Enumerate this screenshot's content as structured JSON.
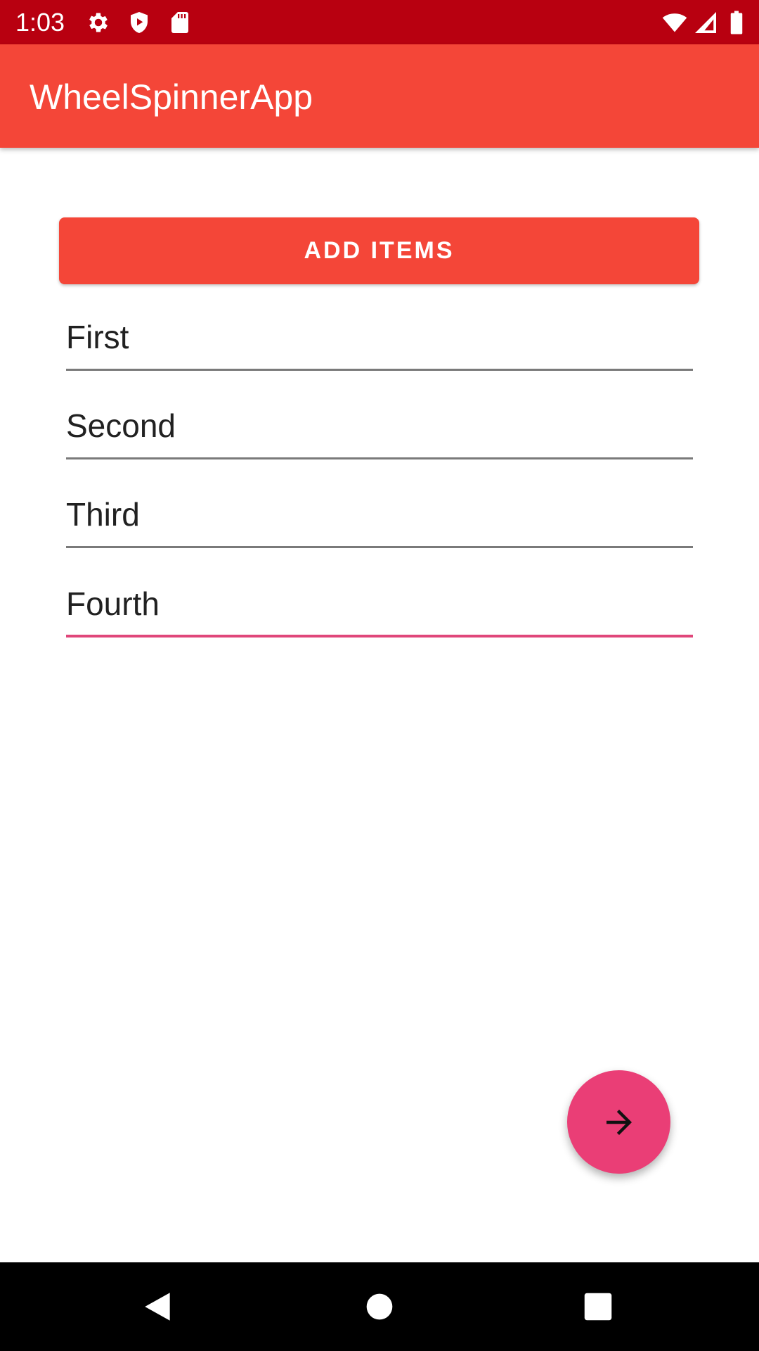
{
  "status_bar": {
    "time": "1:03",
    "icons": [
      "settings-icon",
      "shield-play-icon",
      "sd-card-icon",
      "wifi-icon",
      "cell-signal-icon",
      "battery-icon"
    ],
    "background": "#b80010"
  },
  "app_bar": {
    "title": "WheelSpinnerApp",
    "background": "#f44638"
  },
  "main": {
    "add_button_label": "ADD ITEMS",
    "fields": [
      {
        "value": "First",
        "focused": false
      },
      {
        "value": "Second",
        "focused": false
      },
      {
        "value": "Third",
        "focused": false
      },
      {
        "value": "Fourth",
        "focused": true
      }
    ],
    "focus_color": "#e0467a"
  },
  "fab": {
    "icon": "arrow-forward-icon",
    "color": "#ea3e76"
  },
  "nav_bar": {
    "icons": [
      "back-icon",
      "home-icon",
      "recents-icon"
    ]
  }
}
